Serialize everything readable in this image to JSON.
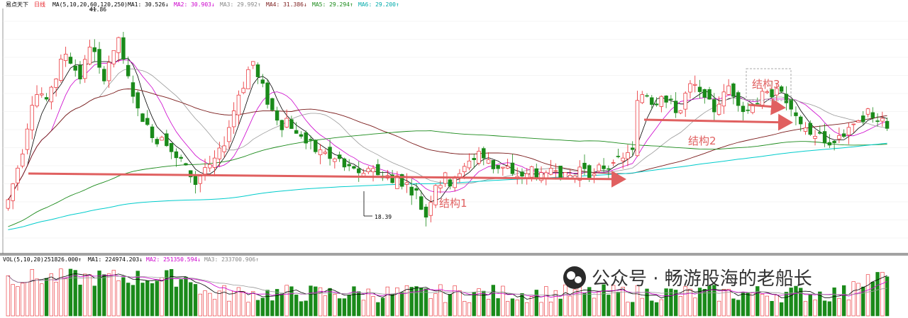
{
  "stock_name": "易点天下",
  "period": "日线",
  "price_indicator": {
    "label": "MA(5,10,20,60,120,250)",
    "items": [
      {
        "label": "MA1: 30.526↓",
        "color": "#000000"
      },
      {
        "label": "MA2: 30.903↓",
        "color": "#cc00cc"
      },
      {
        "label": "MA3: 29.992↑",
        "color": "#888888"
      },
      {
        "label": "MA4: 31.386↓",
        "color": "#7a1a1a"
      },
      {
        "label": "MA5: 29.294↑",
        "color": "#1a8a1a"
      },
      {
        "label": "MA6: 29.200↑",
        "color": "#00cccc"
      }
    ]
  },
  "volume_indicator": {
    "label": "VOL(5,10,20)",
    "value": "251826.000↑",
    "items": [
      {
        "label": "MA1: 224974.203↓",
        "color": "#000000"
      },
      {
        "label": "MA2: 251350.594↓",
        "color": "#cc00cc"
      },
      {
        "label": "MA3: 233700.906↑",
        "color": "#888888"
      }
    ]
  },
  "annotations": {
    "high_label": "41.86",
    "low_label": "18.39",
    "structure1": "结构1",
    "structure2": "结构2",
    "structure3": "结构3"
  },
  "watermark": "公众号 · 畅游股海的老船长",
  "colors": {
    "up": "#e8242a",
    "down": "#1a8a1a",
    "arrow": "#e06060"
  },
  "chart_data": {
    "type": "candlestick",
    "title": "易点天下 日线",
    "high": 41.86,
    "low": 18.39,
    "ylim": [
      16,
      44
    ],
    "n_bars": 248,
    "closes": [
      21,
      23,
      25,
      27,
      30,
      33,
      34,
      34,
      33,
      35,
      36,
      38,
      39,
      38,
      37,
      36,
      38,
      40,
      39,
      37,
      36,
      38,
      39,
      41,
      38,
      36,
      34,
      32,
      31,
      30,
      29,
      28,
      29,
      28,
      27,
      26,
      26,
      25,
      24,
      23,
      24,
      25,
      25,
      26,
      27,
      28,
      30,
      32,
      34,
      35,
      37,
      38,
      36,
      35,
      33,
      32,
      31,
      30,
      31,
      30,
      29,
      29,
      28,
      28,
      27,
      27,
      27,
      26,
      26,
      26,
      25,
      25,
      25,
      24,
      24,
      25,
      25,
      24,
      24,
      24,
      23,
      24,
      23,
      23,
      22,
      22,
      20,
      19,
      21,
      23,
      23,
      24,
      23,
      24,
      24,
      25,
      26,
      26,
      27,
      26,
      26,
      25,
      25,
      25,
      25,
      24,
      24,
      24,
      24,
      25,
      24,
      24,
      24,
      25,
      25,
      24,
      24,
      24,
      24,
      25,
      25,
      24,
      24,
      25,
      25,
      25,
      26,
      26,
      26,
      27,
      27,
      33,
      34,
      34,
      33,
      33,
      34,
      33,
      33,
      32,
      32,
      34,
      35,
      35,
      34,
      34,
      33,
      32,
      33,
      34,
      35,
      34,
      33,
      32,
      32,
      33,
      33,
      34,
      34,
      34,
      35,
      34,
      33,
      32,
      31,
      30,
      30,
      29,
      29,
      29,
      28,
      28,
      28,
      29,
      29,
      30,
      30,
      31,
      31,
      32,
      31,
      31,
      31,
      30
    ],
    "volume_note": "volume bars shown with MA(5,10,20)",
    "series": [
      {
        "name": "MA1",
        "period": 5
      },
      {
        "name": "MA2",
        "period": 10
      },
      {
        "name": "MA3",
        "period": 20
      },
      {
        "name": "MA4",
        "period": 60
      },
      {
        "name": "MA5",
        "period": 120
      },
      {
        "name": "MA6",
        "period": 250
      }
    ]
  }
}
